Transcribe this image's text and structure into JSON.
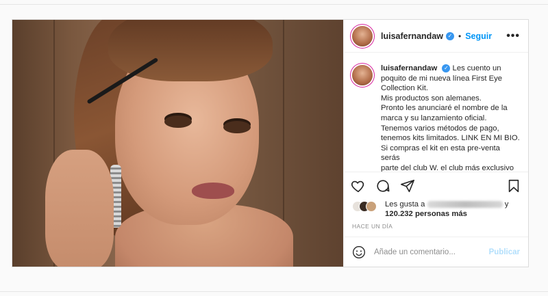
{
  "post": {
    "username": "luisafernandaw",
    "follow_label": "Seguir",
    "more_label": "•••",
    "caption_lines": [
      "Les cuento un",
      "poquito de mi nueva línea First Eye",
      "Collection Kit.",
      "Mis productos son alemanes.",
      "Pronto les anunciaré el nombre de la",
      "marca y su lanzamiento oficial.",
      "Tenemos varios métodos de pago,",
      "tenemos kits limitados. LINK EN MI BIO.",
      "Si compras el kit en esta pre-venta serás",
      "parte del club W. el club más exclusivo"
    ],
    "likes_prefix": "Les gusta a",
    "likes_suffix": "y",
    "likes_count": "120.232 personas más",
    "timestamp": "HACE UN DÍA",
    "comment_placeholder": "Añade un comentario...",
    "publish_label": "Publicar"
  },
  "icons": {
    "verified": "verified-badge-icon",
    "like": "heart-icon",
    "comment": "comment-bubble-icon",
    "share": "paper-plane-icon",
    "save": "bookmark-icon",
    "emoji": "smiley-icon"
  },
  "colors": {
    "accent": "#0095f6",
    "verified": "#3897f0",
    "publish_disabled": "#b2dffc"
  }
}
